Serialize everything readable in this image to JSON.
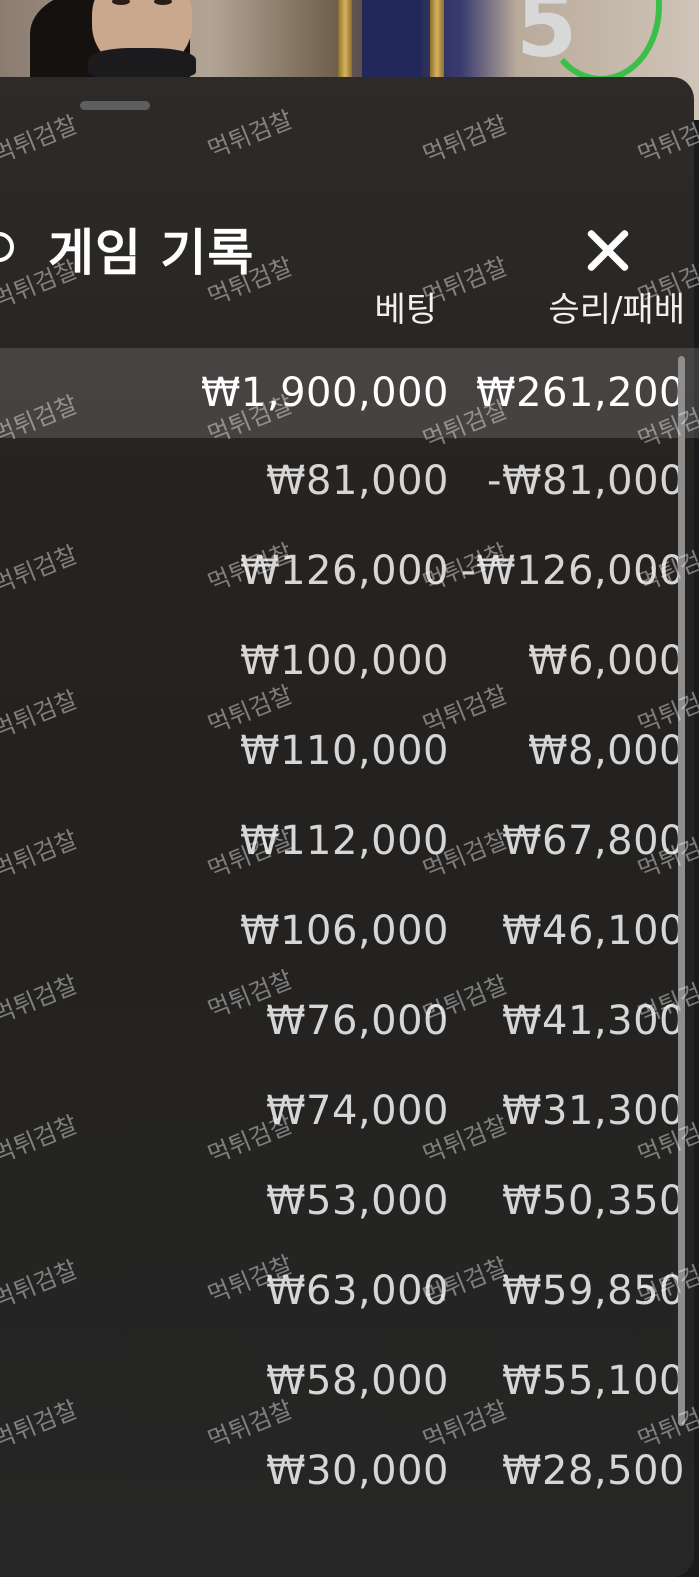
{
  "background": {
    "countdown": "5"
  },
  "panel": {
    "title": "게임 기록",
    "icons": {
      "back": "history-icon",
      "close": "close-icon"
    },
    "columns": {
      "bet": "베팅",
      "win_loss": "승리/패배"
    },
    "rows": [
      {
        "bet": "₩1,900,000",
        "win_loss": "₩261,200"
      },
      {
        "bet": "₩81,000",
        "win_loss": "-₩81,000"
      },
      {
        "bet": "₩126,000",
        "win_loss": "-₩126,000"
      },
      {
        "bet": "₩100,000",
        "win_loss": "₩6,000"
      },
      {
        "bet": "₩110,000",
        "win_loss": "₩8,000"
      },
      {
        "bet": "₩112,000",
        "win_loss": "₩67,800"
      },
      {
        "bet": "₩106,000",
        "win_loss": "₩46,100"
      },
      {
        "bet": "₩76,000",
        "win_loss": "₩41,300"
      },
      {
        "bet": "₩74,000",
        "win_loss": "₩31,300"
      },
      {
        "bet": "₩53,000",
        "win_loss": "₩50,350"
      },
      {
        "bet": "₩63,000",
        "win_loss": "₩59,850"
      },
      {
        "bet": "₩58,000",
        "win_loss": "₩55,100"
      },
      {
        "bet": "₩30,000",
        "win_loss": "₩28,500"
      }
    ]
  },
  "watermark": "먹튀검찰",
  "colors": {
    "accent_ring": "#3cbf4a",
    "panel_bg": "#262626",
    "highlight_row": "#3a3836"
  }
}
